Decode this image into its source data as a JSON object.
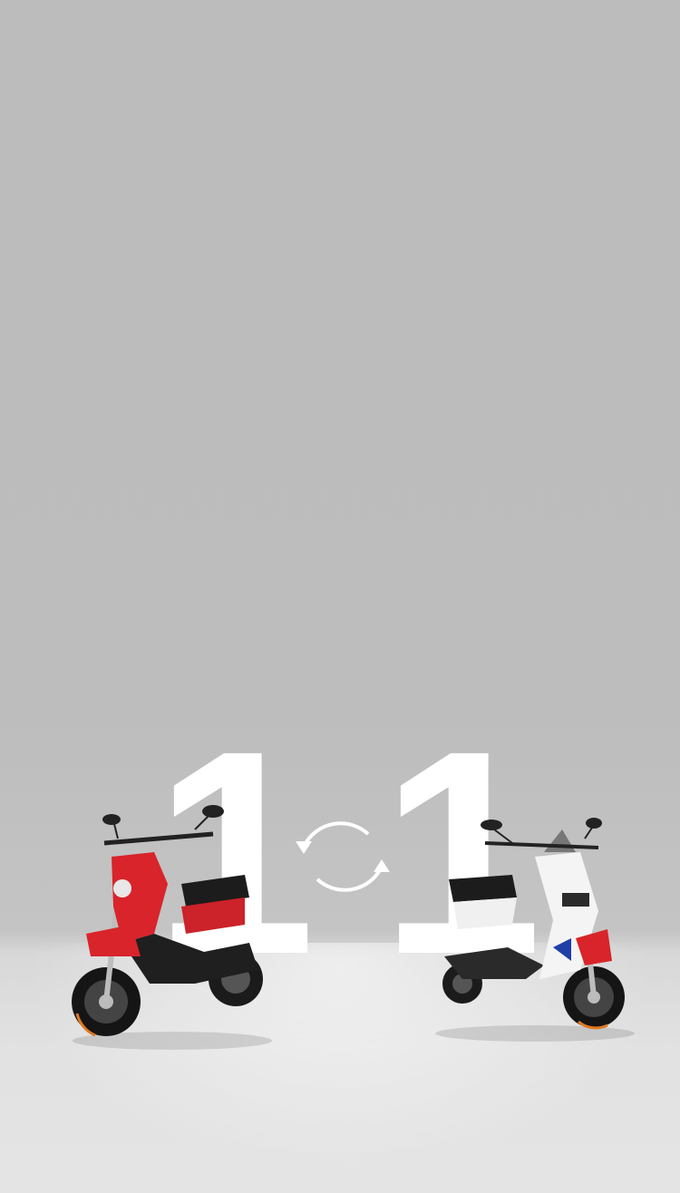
{
  "hero": {
    "left_digit": "1",
    "right_digit": "1",
    "icons": {
      "swap": "swap-arrows-icon",
      "left_product": "red-electric-scooter",
      "right_product": "white-electric-scooter"
    }
  },
  "colors": {
    "background": "#bdbdbd",
    "floor": "#e3e3e3",
    "digit": "#ffffff",
    "red_scooter_body": "#d8242a",
    "white_scooter_body": "#f4f4f4",
    "accent_blue": "#1f3fa8"
  }
}
